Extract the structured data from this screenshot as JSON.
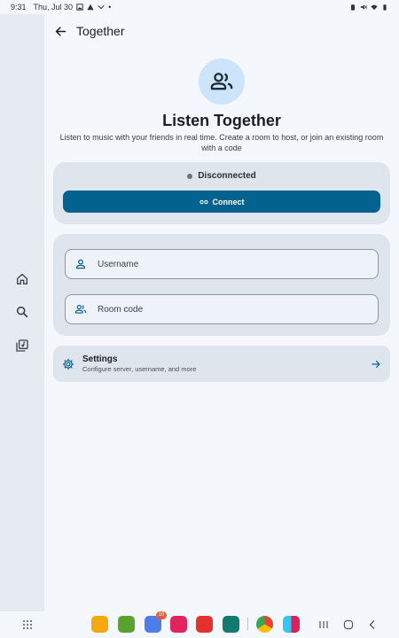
{
  "status_bar": {
    "time": "9:31",
    "date": "Thu, Jul 30"
  },
  "topbar": {
    "title": "Together"
  },
  "hero": {
    "icon": "group-icon",
    "title": "Listen Together",
    "subtitle": "Listen to music with your friends in real time. Create a room to host, or join an existing room with a code"
  },
  "connection": {
    "status": "Disconnected",
    "button_label": "Connect",
    "button_icon": "link-icon"
  },
  "form": {
    "username_placeholder": "Username",
    "roomcode_placeholder": "Room code"
  },
  "settings": {
    "title": "Settings",
    "subtitle": "Configure server, username, and more"
  },
  "rail": {
    "items": [
      "home-icon",
      "search-icon",
      "library-icon"
    ]
  },
  "taskbar": {
    "badge_count": "10"
  },
  "colors": {
    "primary": "#04628f",
    "hero_bg": "#cde5fb",
    "card_bg": "#dfe5ec",
    "page_bg": "#f4f7fb",
    "rail_bg": "#e6ebf2"
  }
}
